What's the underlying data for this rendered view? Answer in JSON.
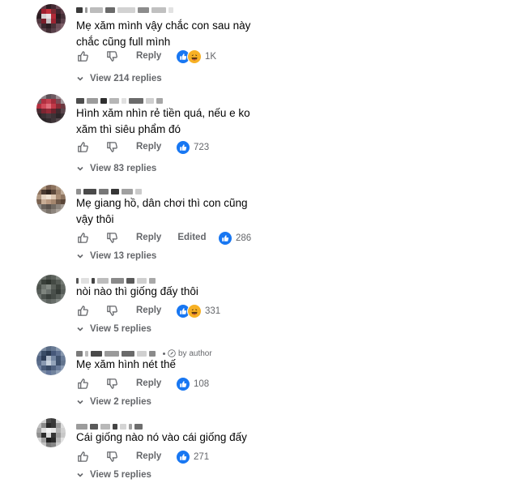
{
  "comments": [
    {
      "text": "Mẹ xăm mình vậy chắc con sau này chắc cũng full mình",
      "reply_label": "Reply",
      "reaction_count": "1K",
      "reactions": [
        "like",
        "haha"
      ],
      "view_replies": "View 214 replies"
    },
    {
      "text": "Hình xăm nhìn rẻ tiền quá, nếu e ko xăm thì siêu phẩm đó",
      "reply_label": "Reply",
      "reaction_count": "723",
      "reactions": [
        "like"
      ],
      "view_replies": "View 83 replies"
    },
    {
      "text": "Mẹ giang hồ, dân chơi thì con cũng vậy thôi",
      "reply_label": "Reply",
      "edited_label": "Edited",
      "reaction_count": "286",
      "reactions": [
        "like"
      ],
      "view_replies": "View 13 replies"
    },
    {
      "text": "nòi nào thì giống đấy thôi",
      "reply_label": "Reply",
      "reaction_count": "331",
      "reactions": [
        "like",
        "haha"
      ],
      "view_replies": "View 5 replies"
    },
    {
      "author_badge": "by author",
      "text": "Mẹ xăm hình nét thế",
      "reply_label": "Reply",
      "reaction_count": "108",
      "reactions": [
        "like"
      ],
      "view_replies": "View 2 replies"
    },
    {
      "text": "Cái giống nào nó vào cái giống đấy",
      "reply_label": "Reply",
      "reaction_count": "271",
      "reactions": [
        "like"
      ],
      "view_replies": "View 5 replies"
    }
  ],
  "colors": {
    "like_blue": "#1877f2",
    "haha_yellow": "#f7b125",
    "secondary_text": "#65676b",
    "primary_text": "#050505"
  },
  "icons": {
    "thumbs_up": "thumbs-up-outline-icon",
    "thumbs_down": "thumbs-down-outline-icon",
    "chevron": "chevron-down-icon"
  }
}
